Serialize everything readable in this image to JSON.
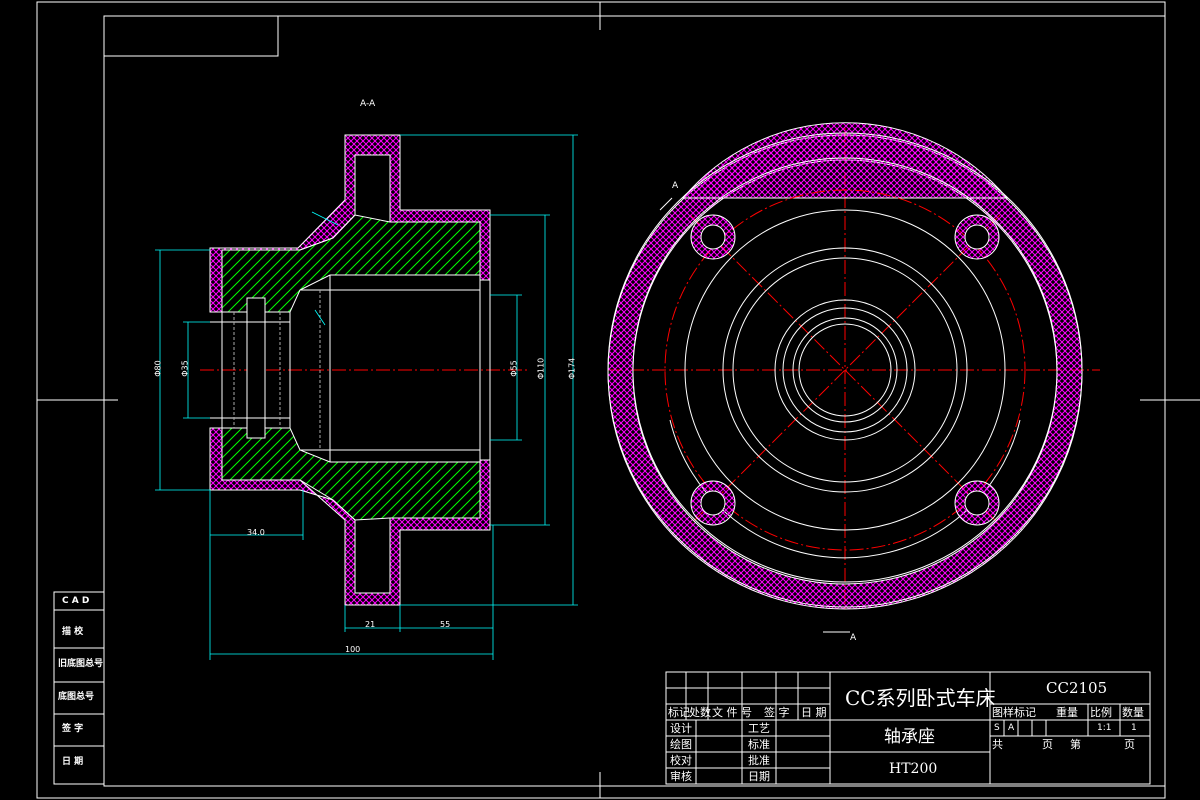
{
  "title_block": {
    "series_name": "CC系列卧式车床",
    "part_name": "轴承座",
    "material": "HT200",
    "drawing_code": "CC2105",
    "header_row": [
      "标记",
      "处数",
      "文 件 号",
      "签 字",
      "日 期"
    ],
    "rows_left": [
      "设计",
      "绘图",
      "校对",
      "审核"
    ],
    "rows_mid": [
      "工艺",
      "标准",
      "批准",
      "日期"
    ],
    "right_header": [
      "图样标记",
      "重量",
      "比例",
      "数量"
    ],
    "right_values": {
      "mark1": "S",
      "mark2": "A",
      "scale": "1:1",
      "qty": "1"
    },
    "sheet_row": [
      "共",
      "页",
      "第",
      "页"
    ]
  },
  "side_table": [
    "C A D",
    "描  校",
    "旧底图总号",
    "底图总号",
    "签  字",
    "日  期"
  ],
  "dimensions": {
    "d34": "34.0",
    "d21": "21",
    "d55": "55",
    "d100": "100",
    "dia_left_outer": "Φ80",
    "dia_left_inner": "Φ35",
    "dia_bore": "Φ55",
    "dia_outer_step": "Φ110",
    "dia_flange": "Φ174"
  },
  "section_label": "A-A",
  "view_label_top": "A",
  "view_label_bottom": "A",
  "colors": {
    "background": "#000000",
    "frame": "#ffffff",
    "outline": "#ffffff",
    "hatch_magenta": "#ff00ff",
    "hatch_green": "#00ff00",
    "dimension": "#00ffff",
    "centerline": "#ff0000"
  }
}
